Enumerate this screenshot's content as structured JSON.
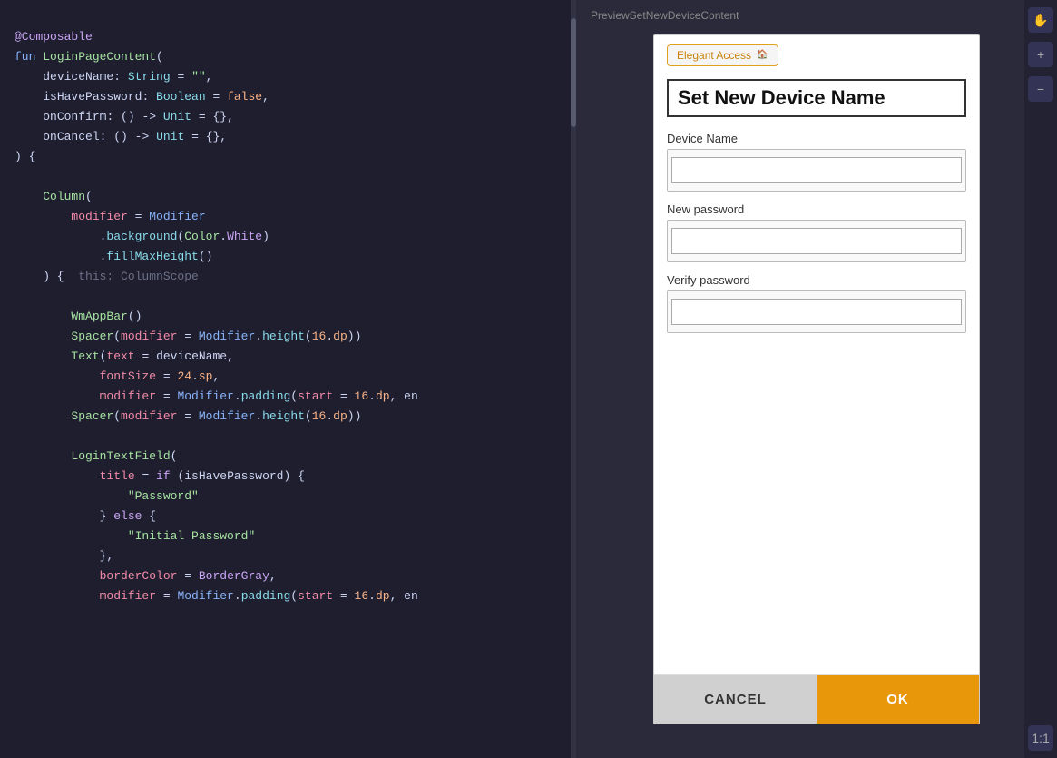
{
  "code_panel": {
    "lines": [
      {
        "text": "@Composable",
        "type": "annotation"
      },
      {
        "text": "fun LoginPageContent(",
        "parts": [
          {
            "t": "fun ",
            "c": "kw-fun"
          },
          {
            "t": "LoginPageContent",
            "c": "kw-func-name"
          },
          {
            "t": "(",
            "c": "kw-param"
          }
        ]
      },
      {
        "text": "    deviceName: String = \"\","
      },
      {
        "text": "    isHavePassword: Boolean = false,"
      },
      {
        "text": "    onConfirm: () -> Unit = {},"
      },
      {
        "text": "    onCancel: () -> Unit = {},"
      },
      {
        "text": ") {"
      },
      {
        "text": ""
      },
      {
        "text": "    Column("
      },
      {
        "text": "        modifier = Modifier"
      },
      {
        "text": "            .background(Color.White)"
      },
      {
        "text": "            .fillMaxHeight()"
      },
      {
        "text": "    ) {  this: ColumnScope"
      },
      {
        "text": ""
      },
      {
        "text": "        WmAppBar()"
      },
      {
        "text": "        Spacer(modifier = Modifier.height(16.dp))"
      },
      {
        "text": "        Text(text = deviceName,"
      },
      {
        "text": "            fontSize = 24.sp,"
      },
      {
        "text": "            modifier = Modifier.padding(start = 16.dp, en"
      },
      {
        "text": "        Spacer(modifier = Modifier.height(16.dp))"
      },
      {
        "text": ""
      },
      {
        "text": "        LoginTextField("
      },
      {
        "text": "            title = if (isHavePassword) {"
      },
      {
        "text": "                \"Password\""
      },
      {
        "text": "            } else {"
      },
      {
        "text": "                \"Initial Password\""
      },
      {
        "text": "            },"
      },
      {
        "text": "            borderColor = BorderGray,"
      },
      {
        "text": "            modifier = Modifier.padding(start = 16.dp, en"
      }
    ]
  },
  "preview": {
    "header_label": "PreviewSetNewDeviceContent",
    "phone": {
      "badge_text": "Elegant Access",
      "badge_icon": "🏠",
      "title": "Set New Device Name",
      "fields": [
        {
          "label": "Device Name",
          "placeholder": "",
          "value": ""
        },
        {
          "label": "New password",
          "placeholder": "",
          "value": ""
        },
        {
          "label": "Verify password",
          "placeholder": "",
          "value": ""
        }
      ],
      "cancel_label": "CANCEL",
      "ok_label": "OK"
    }
  },
  "sidebar": {
    "tools": [
      {
        "label": "✋",
        "name": "hand-tool"
      },
      {
        "label": "+",
        "name": "zoom-in"
      },
      {
        "label": "−",
        "name": "zoom-out"
      },
      {
        "label": "1:1",
        "name": "actual-size"
      }
    ]
  }
}
